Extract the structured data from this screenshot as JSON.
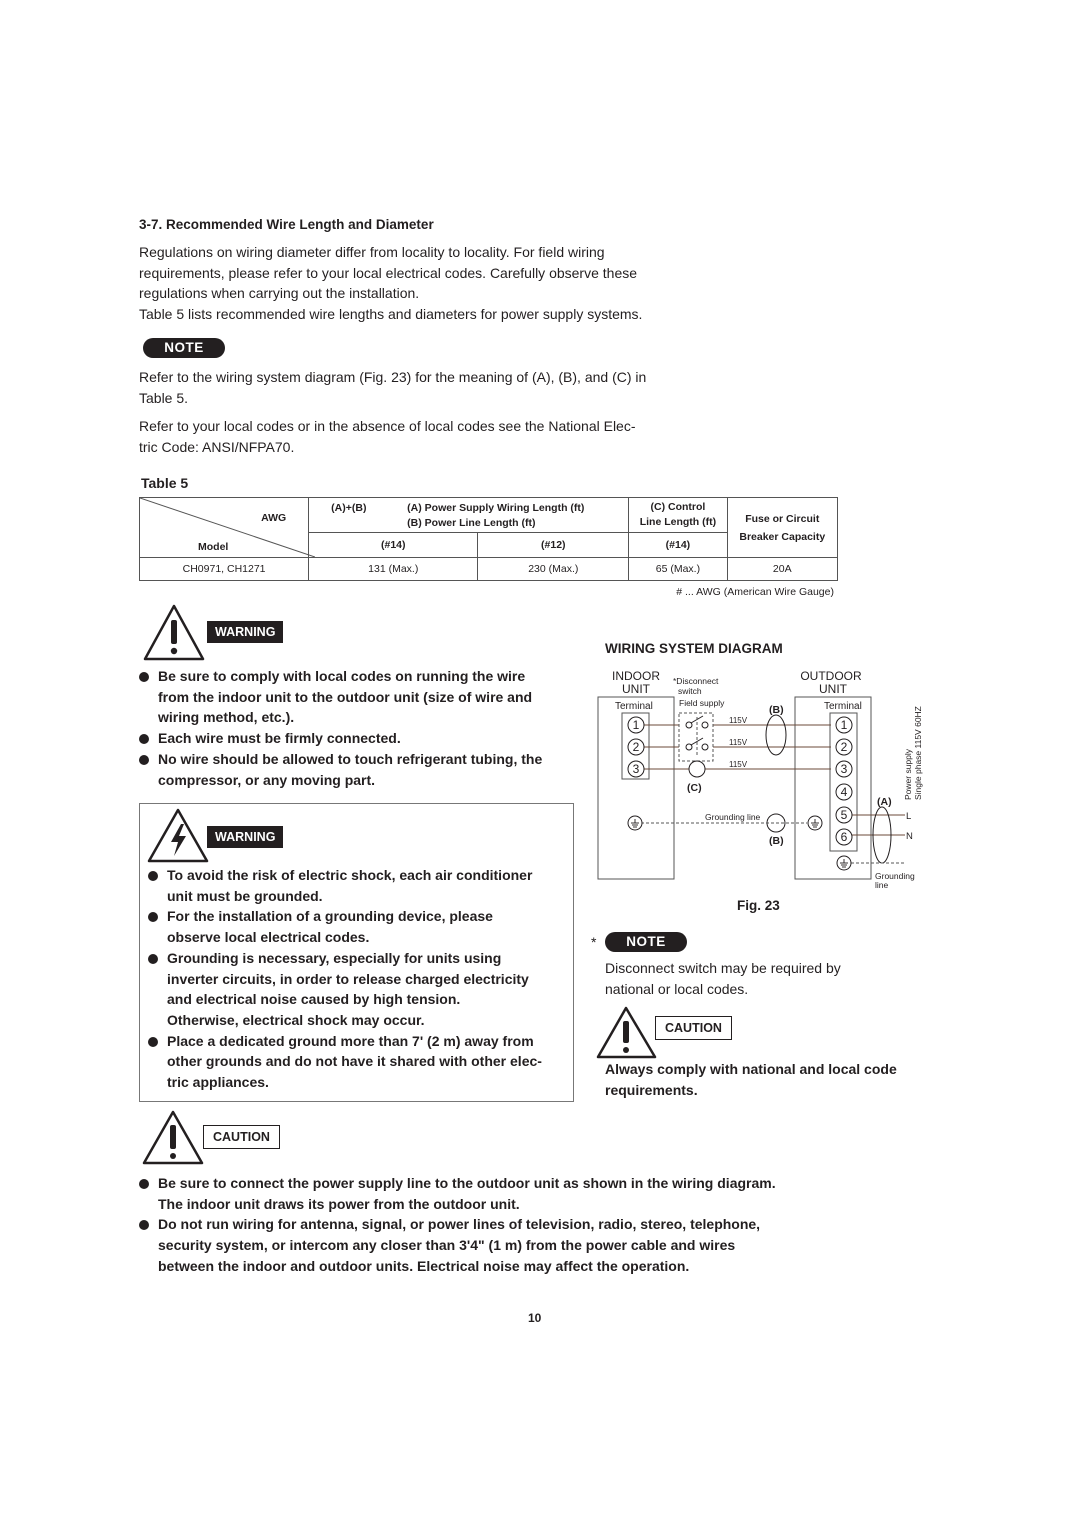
{
  "section": {
    "heading": "3-7.  Recommended Wire Length and Diameter",
    "intro_lines": [
      "Regulations on wiring diameter differ from locality to locality. For field wiring",
      "requirements, please refer to your local electrical codes. Carefully observe these",
      "regulations when carrying out the installation.",
      "Table 5 lists recommended wire lengths and diameters for power supply systems."
    ],
    "note_label": "NOTE",
    "note_lines": [
      "Refer to the wiring system diagram (Fig. 23) for the meaning of (A), (B), and (C) in",
      "Table 5."
    ],
    "codes_lines": [
      "Refer to your local codes or in the absence of local codes see the National Elec-",
      "tric Code: ANSI/NFPA70."
    ]
  },
  "table5": {
    "title": "Table 5",
    "corner_top": "AWG",
    "corner_bottom": "Model",
    "col_ab": "(A)+(B)",
    "col_a": "(A) Power Supply Wiring Length (ft)",
    "col_b": "(B) Power Line Length (ft)",
    "col_c1": "(C) Control",
    "col_c2": "Line Length (ft)",
    "col_fuse1": "Fuse or Circuit",
    "col_fuse2": "Breaker Capacity",
    "gauges": [
      "(#14)",
      "(#12)",
      "(#14)"
    ],
    "rows": [
      {
        "model": "CH0971, CH1271",
        "ab_14": "131 (Max.)",
        "ab_12": "230 (Max.)",
        "c_14": "65 (Max.)",
        "fuse": "20A"
      }
    ],
    "footnote": "# ... AWG (American Wire Gauge)"
  },
  "warning1": {
    "label": "WARNING",
    "items": [
      [
        "Be sure to comply with local codes on running the wire",
        "from the indoor unit to the outdoor unit (size of wire and",
        "wiring method, etc.)."
      ],
      [
        "Each wire must be firmly connected."
      ],
      [
        "No wire should be allowed to touch refrigerant tubing, the",
        "compressor, or any moving part."
      ]
    ]
  },
  "warning2": {
    "label": "WARNING",
    "items": [
      [
        "To avoid the risk of electric shock, each air conditioner",
        "unit must be grounded."
      ],
      [
        "For the installation of a grounding device, please",
        "observe local electrical codes."
      ],
      [
        "Grounding is necessary, especially for units using",
        "inverter circuits, in order to release charged electricity",
        "and electrical noise caused by high tension.",
        "Otherwise, electrical shock may occur."
      ],
      [
        "Place a dedicated ground more than 7' (2 m) away from",
        "other grounds and do not have it shared with other elec-",
        "tric appliances."
      ]
    ]
  },
  "diagram": {
    "title": "WIRING SYSTEM DIAGRAM",
    "indoor_1": "INDOOR",
    "indoor_2": "UNIT",
    "outdoor_1": "OUTDOOR",
    "outdoor_2": "UNIT",
    "disconnect_1": "*Disconnect",
    "disconnect_2": "switch",
    "field_supply": "Field supply",
    "terminal": "Terminal",
    "terminals_indoor": [
      "1",
      "2",
      "3"
    ],
    "terminals_outdoor": [
      "1",
      "2",
      "3",
      "4",
      "5",
      "6"
    ],
    "voltage": "115V",
    "label_a": "(A)",
    "label_b": "(B)",
    "label_c": "(C)",
    "grounding_line": "Grounding line",
    "grounding_1": "Grounding",
    "grounding_2": "line",
    "l": "L",
    "n": "N",
    "power_1": "Power supply",
    "power_2": "Single phase 115V 60HZ",
    "fig": "Fig. 23"
  },
  "note2": {
    "star": "*",
    "label": "NOTE",
    "lines": [
      "Disconnect switch may be required by",
      "national or local codes."
    ]
  },
  "caution1": {
    "label": "CAUTION",
    "lines": [
      "Always comply with national and local code",
      "requirements."
    ]
  },
  "caution2": {
    "label": "CAUTION",
    "items": [
      [
        "Be sure to connect the power supply line to the outdoor unit as shown in the wiring diagram.",
        "The indoor unit draws its power from the outdoor unit."
      ],
      [
        "Do not run wiring for antenna, signal, or power lines of television, radio, stereo, telephone,",
        "security system, or intercom any closer than 3'4\" (1 m) from the power cable and wires",
        "between the indoor and outdoor units. Electrical noise may affect the operation."
      ]
    ]
  },
  "page_number": "10"
}
